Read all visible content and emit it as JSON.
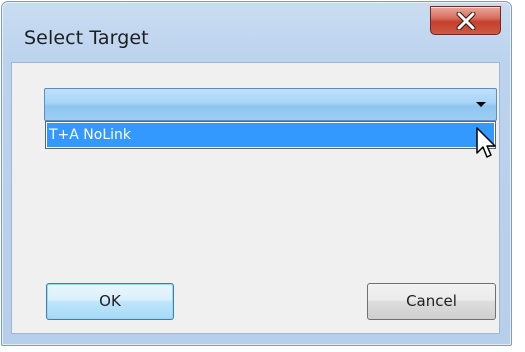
{
  "window": {
    "title": "Select Target"
  },
  "icons": {
    "close": "close-icon",
    "dropdown_arrow": "chevron-down-icon",
    "cursor": "mouse-pointer-icon"
  },
  "dropdown": {
    "selected_value": "",
    "options": [
      "T+A NoLink"
    ],
    "highlighted_option": "T+A NoLink"
  },
  "buttons": {
    "ok_label": "OK",
    "cancel_label": "Cancel"
  },
  "colors": {
    "selection_highlight": "#3399ff",
    "close_button": "#c4402c",
    "frame": "#bcd3ee"
  }
}
